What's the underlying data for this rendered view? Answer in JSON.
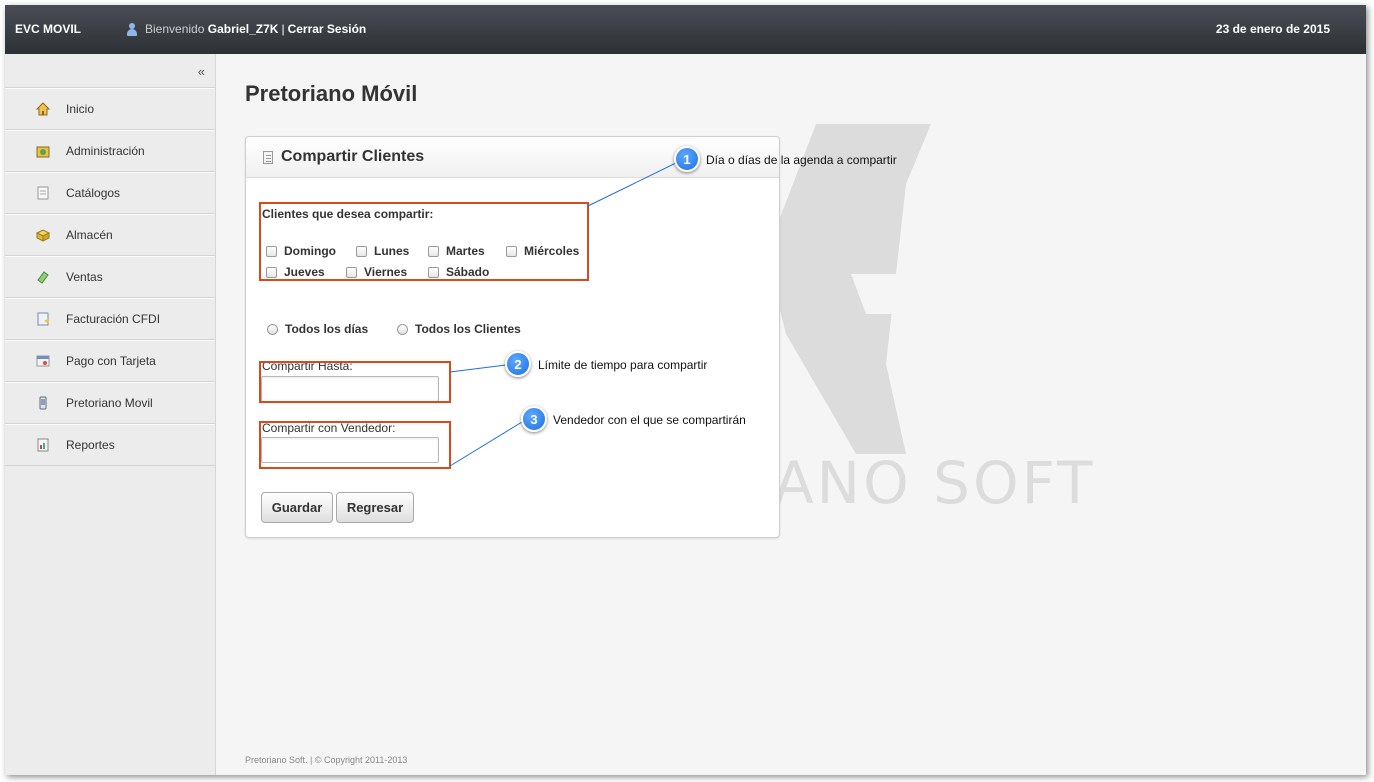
{
  "topbar": {
    "brand": "EVC MOVIL",
    "welcome": "Bienvenido",
    "username": "Gabriel_Z7K",
    "separator": "|",
    "logout": "Cerrar Sesión",
    "date": "23 de enero de 2015"
  },
  "sidebar": {
    "collapse": "«",
    "items": [
      {
        "label": "Inicio",
        "icon": "home-icon"
      },
      {
        "label": "Administración",
        "icon": "admin-icon"
      },
      {
        "label": "Catálogos",
        "icon": "catalog-icon"
      },
      {
        "label": "Almacén",
        "icon": "warehouse-icon"
      },
      {
        "label": "Ventas",
        "icon": "sales-icon"
      },
      {
        "label": "Facturación CFDI",
        "icon": "invoice-icon"
      },
      {
        "label": "Pago con Tarjeta",
        "icon": "card-payment-icon"
      },
      {
        "label": "Pretoriano Movil",
        "icon": "mobile-icon"
      },
      {
        "label": "Reportes",
        "icon": "reports-icon"
      }
    ]
  },
  "main": {
    "page_title": "Pretoriano Móvil",
    "watermark": "ANO SOFT",
    "panel": {
      "title": "Compartir Clientes",
      "clients_label": "Clientes que desea compartir:",
      "days": [
        "Domingo",
        "Lunes",
        "Martes",
        "Miércoles",
        "Jueves",
        "Viernes",
        "Sábado"
      ],
      "radios": [
        "Todos los días",
        "Todos los Clientes"
      ],
      "share_until_label": "Compartir Hasta:",
      "share_until_value": "",
      "share_with_label": "Compartir con Vendedor:",
      "share_with_value": "",
      "save_button": "Guardar",
      "back_button": "Regresar"
    },
    "callouts": [
      {
        "number": "1",
        "text": "Día o días de la agenda a compartir"
      },
      {
        "number": "2",
        "text": "Límite de tiempo para compartir"
      },
      {
        "number": "3",
        "text": "Vendedor con el que se compartirán"
      }
    ],
    "footer": "Pretoriano Soft. | © Copyright 2011-2013"
  },
  "colors": {
    "topbar": "#2d3035",
    "highlight": "#d84a1b",
    "callout": "#1a6fe0"
  }
}
